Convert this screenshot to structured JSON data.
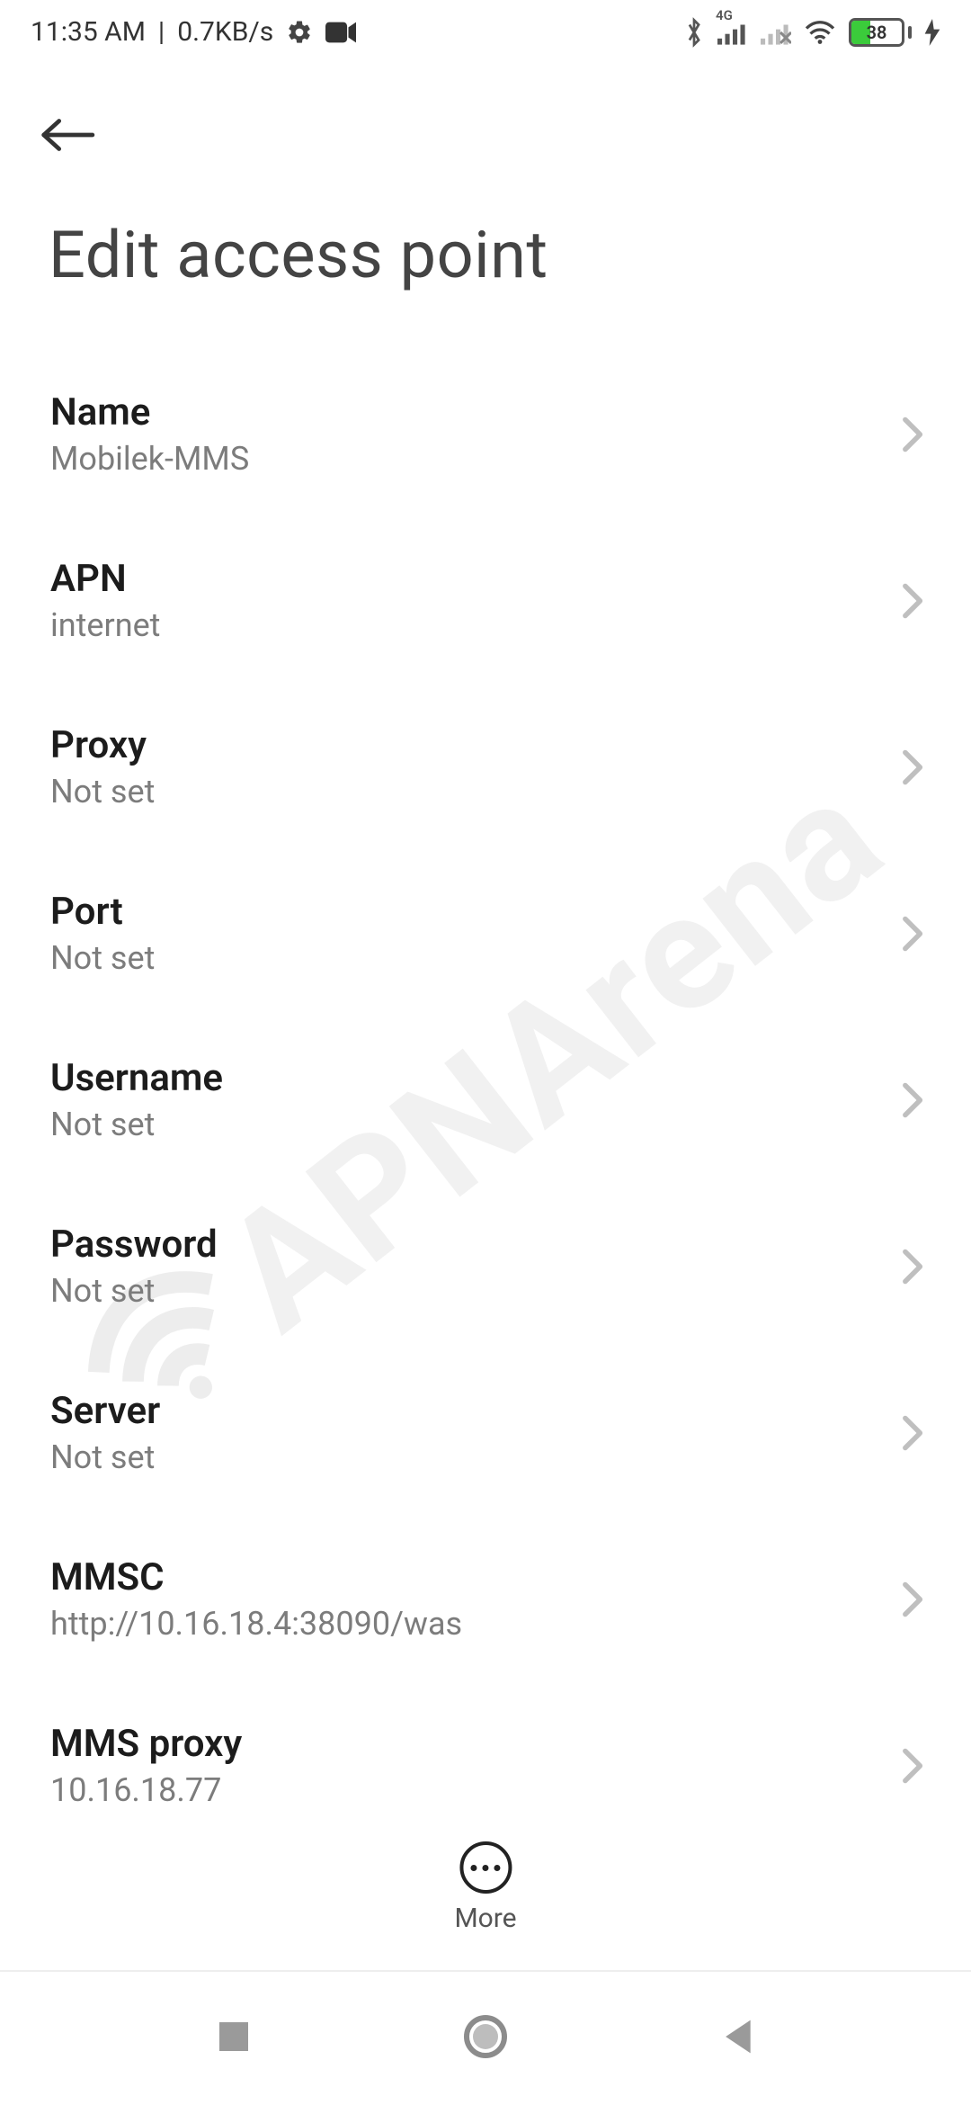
{
  "status_bar": {
    "time": "11:35 AM",
    "separator": "|",
    "net_speed": "0.7KB/s",
    "net_tag": "4G",
    "battery_pct": "38",
    "battery_fill_pct": 38
  },
  "header": {
    "title": "Edit access point"
  },
  "settings": [
    {
      "key": "name",
      "label": "Name",
      "value": "Mobilek-MMS"
    },
    {
      "key": "apn",
      "label": "APN",
      "value": "internet"
    },
    {
      "key": "proxy",
      "label": "Proxy",
      "value": "Not set"
    },
    {
      "key": "port",
      "label": "Port",
      "value": "Not set"
    },
    {
      "key": "username",
      "label": "Username",
      "value": "Not set"
    },
    {
      "key": "password",
      "label": "Password",
      "value": "Not set"
    },
    {
      "key": "server",
      "label": "Server",
      "value": "Not set"
    },
    {
      "key": "mmsc",
      "label": "MMSC",
      "value": "http://10.16.18.4:38090/was"
    },
    {
      "key": "mms-proxy",
      "label": "MMS proxy",
      "value": "10.16.18.77"
    }
  ],
  "more_button": {
    "label": "More"
  },
  "watermark_text": "APNArena"
}
